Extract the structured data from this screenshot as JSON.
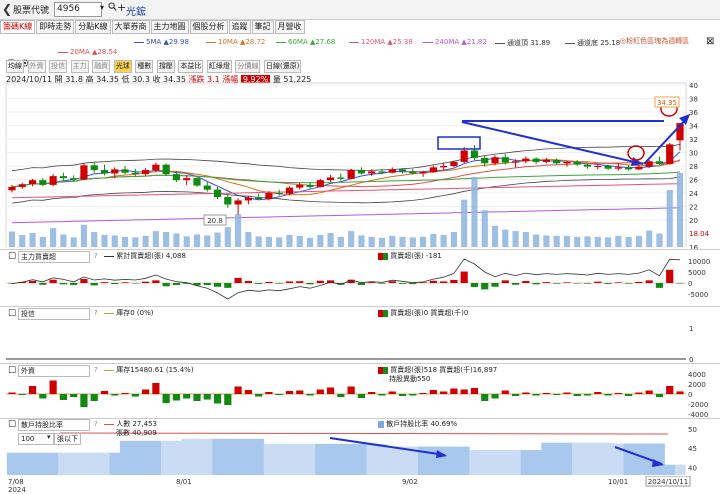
{
  "topbar": {
    "back_icon": "back-arrow-icon",
    "label": "股票代號",
    "code": "4956",
    "search_icon": "magnifier-icon",
    "plus": "+",
    "stock_name": "光鋐"
  },
  "tabs": [
    "籌碼K線",
    "即時走勢",
    "分點K線",
    "大單券商",
    "主力地圖",
    "個股分析",
    "追蹤",
    "筆記",
    "月營收"
  ],
  "ma_legend": [
    {
      "label": "5MA ▲29.98",
      "color": "#3b4fd8"
    },
    {
      "label": "10MA ▲28.72",
      "color": "#d4731b"
    },
    {
      "label": "60MA ▲27.68",
      "color": "#3fa33f"
    },
    {
      "label": "120MA ▲25.38",
      "color": "#e0557a"
    },
    {
      "label": "240MA ▲21.82",
      "color": "#b45ad8"
    },
    {
      "label": "通道頂 31.89",
      "color": "#555555"
    },
    {
      "label": "通道底 25.18",
      "color": "#555555"
    },
    {
      "label": "20MA ▲28.54",
      "color": "#e05050"
    }
  ],
  "promo": "◎粉紅色區塊為週轉區",
  "close_icon": "⊠",
  "info": {
    "period": "日",
    "date": "2024/10/11",
    "open": "開 31.8",
    "high": "高 34.35",
    "low": "低 30.3",
    "close": "收 34.35",
    "chg_label": "漲跌",
    "chg": "3.1",
    "pct_label": "漲幅",
    "pct": "9.92%",
    "vol_label": "量",
    "vol": "51,225"
  },
  "price_tools": [
    "均線",
    "外資",
    "投信",
    "主力",
    "融資",
    "光球",
    "種數",
    "撐壓",
    "本益比",
    "紅綠燈",
    "分價線",
    "日線(還原)"
  ],
  "price_axis": [
    "40",
    "38",
    "36",
    "34",
    "32",
    "30",
    "28",
    "26",
    "24",
    "22",
    "20",
    "18.04",
    "16"
  ],
  "chart_labels": {
    "high_tag": "34.35",
    "low_tag": "20.8"
  },
  "panels": {
    "main_force": {
      "select": "主力買賣超",
      "help": "?",
      "cum": "累計買賣超(張) 4,088",
      "net": "買賣超(張) -181",
      "axis": [
        "10000",
        "5000",
        "0",
        "-5000"
      ]
    },
    "trust": {
      "select": "投信",
      "help": "?",
      "stock": "庫存0 (0%)",
      "net": "買賣超(張)0 買賣超(千)0",
      "axis": [
        "1",
        "0"
      ]
    },
    "foreign": {
      "select": "外資",
      "help": "?",
      "stock": "庫存15480.61 (15.4%)",
      "net": "買賣超(張)518 買賣超(千)16,897",
      "hold": "持股異動550",
      "axis": [
        "4000",
        "2000",
        "0",
        "-2000",
        "-4000"
      ]
    },
    "holders": {
      "select": "散戶持股比率",
      "help": "?",
      "count_select": "100",
      "count_btn": "張以下",
      "people": "人數 27,453",
      "pct_line": "張數 40,909",
      "ratio": "散戶持股比率 40.69%",
      "axis": [
        "50",
        "45",
        "40"
      ]
    }
  },
  "x_axis": [
    "7/08\n2024",
    "8/01",
    "9/02",
    "10/01",
    "2024/10/11"
  ],
  "chart_data": {
    "type": "candlestick",
    "y_range": [
      16,
      40
    ],
    "candles": [
      [
        24.4,
        25.2,
        24.1,
        24.9
      ],
      [
        24.9,
        25.5,
        24.6,
        25.3
      ],
      [
        25.3,
        26.1,
        25.0,
        25.9
      ],
      [
        25.9,
        26.2,
        25.0,
        25.2
      ],
      [
        25.2,
        26.8,
        25.0,
        26.5
      ],
      [
        26.5,
        27.0,
        25.9,
        26.2
      ],
      [
        26.2,
        26.6,
        25.7,
        26.0
      ],
      [
        26.0,
        28.4,
        25.9,
        28.1
      ],
      [
        28.1,
        28.6,
        27.0,
        27.4
      ],
      [
        27.4,
        28.2,
        26.6,
        26.9
      ],
      [
        26.9,
        27.8,
        26.2,
        27.5
      ],
      [
        27.5,
        28.0,
        26.8,
        27.0
      ],
      [
        27.0,
        27.6,
        26.4,
        26.8
      ],
      [
        26.8,
        27.7,
        26.5,
        27.4
      ],
      [
        27.4,
        28.5,
        27.1,
        28.2
      ],
      [
        28.2,
        28.4,
        26.5,
        26.8
      ],
      [
        26.8,
        27.2,
        25.6,
        25.9
      ],
      [
        25.9,
        26.6,
        25.2,
        26.2
      ],
      [
        26.2,
        26.4,
        24.9,
        25.1
      ],
      [
        25.1,
        25.6,
        24.2,
        24.5
      ],
      [
        24.5,
        24.9,
        23.1,
        23.4
      ],
      [
        23.4,
        23.8,
        21.8,
        22.3
      ],
      [
        22.3,
        23.2,
        20.8,
        22.9
      ],
      [
        22.9,
        23.6,
        22.3,
        23.3
      ],
      [
        23.3,
        23.9,
        22.9,
        23.1
      ],
      [
        23.1,
        24.3,
        22.9,
        24.0
      ],
      [
        24.0,
        24.5,
        23.6,
        23.9
      ],
      [
        23.9,
        25.0,
        23.7,
        24.8
      ],
      [
        24.8,
        25.5,
        24.5,
        25.2
      ],
      [
        25.2,
        25.6,
        24.6,
        24.9
      ],
      [
        24.9,
        26.1,
        24.8,
        25.9
      ],
      [
        25.9,
        26.7,
        25.6,
        26.3
      ],
      [
        26.3,
        26.9,
        25.8,
        26.1
      ],
      [
        26.1,
        27.6,
        26.0,
        27.4
      ],
      [
        27.4,
        27.8,
        26.7,
        26.9
      ],
      [
        26.9,
        27.5,
        26.5,
        27.2
      ],
      [
        27.2,
        27.6,
        26.8,
        27.0
      ],
      [
        27.0,
        27.8,
        26.9,
        27.5
      ],
      [
        27.5,
        27.7,
        26.9,
        27.2
      ],
      [
        27.2,
        27.6,
        26.7,
        26.9
      ],
      [
        26.9,
        27.3,
        26.4,
        27.1
      ],
      [
        27.1,
        28.1,
        27.0,
        27.8
      ],
      [
        27.8,
        28.4,
        27.4,
        28.0
      ],
      [
        28.0,
        28.8,
        27.8,
        28.6
      ],
      [
        28.6,
        30.8,
        28.4,
        30.3
      ],
      [
        30.3,
        31.1,
        28.9,
        29.2
      ],
      [
        29.2,
        29.6,
        27.9,
        28.4
      ],
      [
        28.4,
        29.6,
        28.1,
        29.3
      ],
      [
        29.3,
        29.8,
        28.2,
        28.5
      ],
      [
        28.5,
        29.0,
        27.8,
        28.7
      ],
      [
        28.7,
        29.4,
        28.4,
        29.1
      ],
      [
        29.1,
        29.3,
        28.3,
        28.6
      ],
      [
        28.6,
        29.2,
        28.4,
        28.9
      ],
      [
        28.9,
        29.1,
        28.2,
        28.4
      ],
      [
        28.4,
        28.8,
        27.9,
        28.6
      ],
      [
        28.6,
        28.9,
        28.0,
        28.2
      ],
      [
        28.2,
        28.5,
        27.6,
        27.9
      ],
      [
        27.9,
        28.3,
        27.5,
        28.0
      ],
      [
        28.0,
        28.2,
        27.4,
        27.6
      ],
      [
        27.6,
        28.4,
        27.3,
        27.8
      ],
      [
        27.8,
        28.1,
        27.3,
        27.5
      ],
      [
        27.5,
        28.2,
        27.4,
        27.9
      ],
      [
        27.9,
        28.9,
        27.7,
        28.7
      ],
      [
        28.7,
        29.4,
        28.1,
        28.3
      ],
      [
        28.3,
        31.4,
        28.2,
        31.2
      ],
      [
        31.8,
        34.35,
        30.3,
        34.35
      ]
    ],
    "volume": [
      3200,
      2500,
      2900,
      2100,
      3900,
      2600,
      2000,
      4600,
      3100,
      2500,
      2400,
      2100,
      2000,
      2300,
      3300,
      3100,
      2800,
      2200,
      2600,
      2400,
      3000,
      4100,
      6800,
      3100,
      2200,
      2100,
      2000,
      2500,
      2300,
      1900,
      2500,
      2900,
      2100,
      3300,
      2400,
      2100,
      1900,
      2300,
      2100,
      2000,
      2100,
      2700,
      2500,
      3100,
      9800,
      14500,
      7600,
      4400,
      3600,
      3300,
      3100,
      2600,
      2400,
      2300,
      2300,
      2100,
      2200,
      2100,
      2000,
      2300,
      2100,
      2300,
      3400,
      2800,
      11800,
      51225
    ],
    "main_force_net": [
      -300,
      500,
      900,
      -800,
      1500,
      -600,
      -900,
      1800,
      -1100,
      400,
      -500,
      300,
      -200,
      600,
      1200,
      -1500,
      -900,
      -400,
      -1100,
      -900,
      -1700,
      -2200,
      2300,
      900,
      -400,
      500,
      -300,
      700,
      800,
      -600,
      1000,
      1200,
      -800,
      1500,
      -900,
      400,
      -300,
      800,
      -400,
      -500,
      300,
      1000,
      700,
      1400,
      5200,
      -1800,
      -2900,
      -1700,
      1200,
      -800,
      900,
      -600,
      400,
      -300,
      300,
      -200,
      -300,
      600,
      -400,
      300,
      -300,
      500,
      1200,
      -2200,
      6000,
      -181
    ],
    "foreign_net": [
      300,
      -200,
      1600,
      -900,
      2700,
      -1200,
      -600,
      -2600,
      -1400,
      600,
      -300,
      200,
      -500,
      900,
      2200,
      -1800,
      -1300,
      -900,
      -1400,
      -1100,
      -1900,
      -2200,
      1500,
      800,
      -500,
      400,
      -200,
      600,
      700,
      -300,
      900,
      1300,
      -600,
      1500,
      -800,
      400,
      -300,
      500,
      -400,
      -300,
      200,
      800,
      500,
      1100,
      900,
      1200,
      -1400,
      -900,
      700,
      -400,
      300,
      -300,
      200,
      -200,
      300,
      -400,
      -300,
      400,
      -300,
      200,
      -400,
      300,
      700,
      -600,
      1600,
      518
    ],
    "retail_holders_ratio": [
      43.8,
      43.8,
      43.8,
      43.8,
      43.8,
      43.8,
      43.8,
      43.8,
      43.8,
      43.8,
      43.8,
      46.9,
      46.9,
      46.9,
      46.9,
      46.9,
      46.9,
      47.4,
      47.4,
      47.4,
      47.4,
      47.4,
      47.4,
      47.4,
      47.4,
      46.1,
      46.1,
      46.1,
      46.1,
      46.1,
      46.1,
      46.1,
      46.1,
      46.1,
      46.1,
      46.1,
      46.1,
      45.4,
      45.4,
      45.4,
      45.4,
      45.4,
      45.4,
      45.4,
      45.4,
      44.5,
      44.5,
      44.5,
      44.5,
      44.5,
      44.5,
      44.5,
      46.4,
      46.4,
      46.4,
      46.4,
      46.4,
      46.4,
      46.4,
      46.2,
      46.2,
      46.2,
      46.2,
      46.2,
      40.69,
      40.69
    ]
  }
}
